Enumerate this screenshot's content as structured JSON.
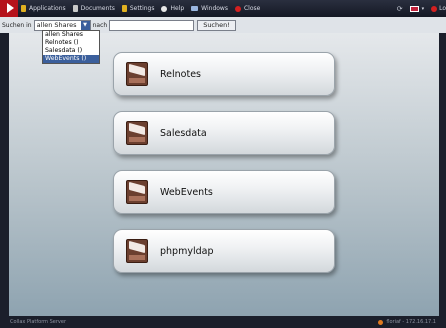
{
  "topbar": {
    "menu": [
      {
        "label": "Applications",
        "icon": "apps-icon",
        "color": "#e0b020"
      },
      {
        "label": "Documents",
        "icon": "documents-icon",
        "color": "#c9c9c9"
      },
      {
        "label": "Settings",
        "icon": "settings-icon",
        "color": "#e0b020"
      },
      {
        "label": "Help",
        "icon": "help-icon",
        "color": "#e8e8e8"
      },
      {
        "label": "Windows",
        "icon": "windows-icon",
        "color": "#9ab6e0"
      },
      {
        "label": "Close",
        "icon": "close-icon",
        "color": "#d42020"
      }
    ],
    "right_label": "Lo"
  },
  "search": {
    "label_in": "Suchen in",
    "scope_value": "allen Shares",
    "label_for": "nach",
    "query_value": "",
    "button_label": "Suchen!",
    "options": [
      "allen Shares",
      "Relnotes ()",
      "Salesdata ()",
      "WebEvents ()"
    ],
    "selected_index": 3
  },
  "shares": [
    {
      "label": "Relnotes"
    },
    {
      "label": "Salesdata"
    },
    {
      "label": "WebEvents"
    },
    {
      "label": "phpmyldap"
    }
  ],
  "footer": {
    "left": "Collax Platform Server",
    "right": "floriaf - 172.16.17.1"
  },
  "colors": {
    "accent_red": "#b5121b",
    "select_blue": "#3b5f9c"
  }
}
